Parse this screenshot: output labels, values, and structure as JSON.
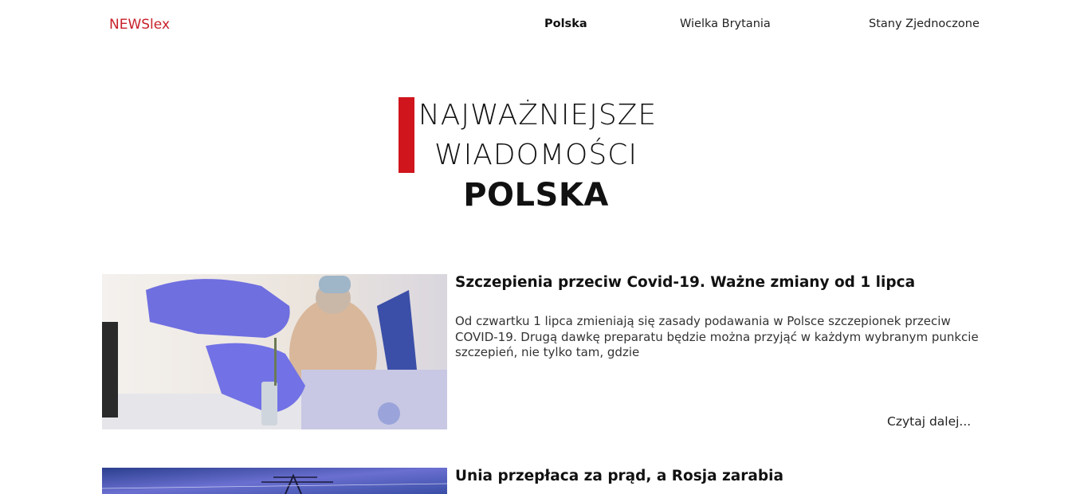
{
  "brand": {
    "logo_text": "NEWSlex",
    "accent_color": "#c8202a"
  },
  "nav": {
    "items": [
      {
        "label": "Polska",
        "active": true
      },
      {
        "label": "Wielka Brytania",
        "active": false
      },
      {
        "label": "Stany Zjednoczone",
        "active": false
      }
    ]
  },
  "hero": {
    "line1": "NAJWAŻNIEJSZE",
    "line2": "WIADOMOŚCI",
    "country": "POLSKA",
    "bar_color": "#d0151d"
  },
  "articles": [
    {
      "title": "Szczepienia przeciw Covid-19. Ważne zmiany od 1 lipca",
      "excerpt": "Od czwartku 1 lipca zmieniają się zasady podawania w Polsce szczepionek przeciw COVID-19. Drugą dawkę preparatu będzie można przyjąć w każdym wybranym punkcie szczepień, nie tylko tam, gdzie",
      "read_more": "Czytaj dalej..."
    },
    {
      "title": "Unia przepłaca za prąd, a Rosja zarabia"
    }
  ]
}
